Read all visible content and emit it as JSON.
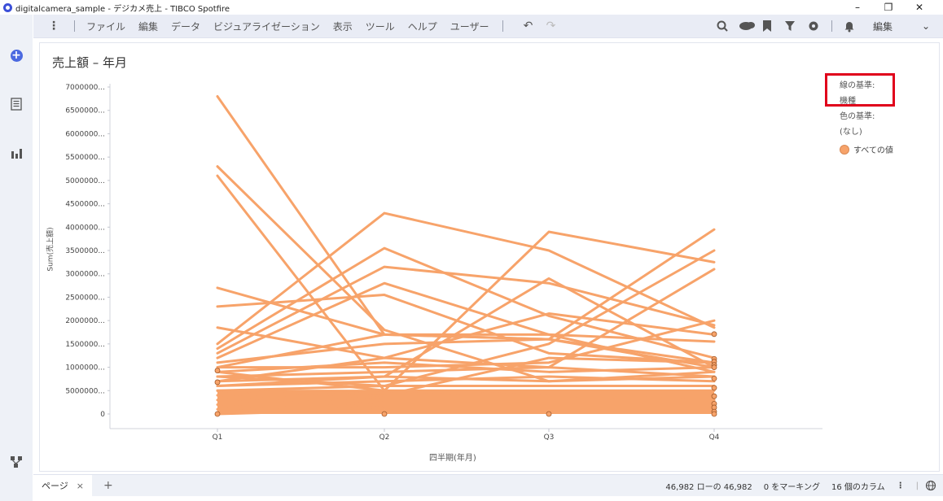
{
  "window": {
    "title": "digitalcamera_sample - デジカメ売上 - TIBCO Spotfire",
    "minimize": "–",
    "restore": "❐",
    "close": "✕"
  },
  "menu": {
    "items": [
      "ファイル",
      "編集",
      "データ",
      "ビジュアライゼーション",
      "表示",
      "ツール",
      "ヘルプ",
      "ユーザー"
    ],
    "edit_mode": "編集"
  },
  "visualization": {
    "title": "売上額 – 年月",
    "xlabel": "四半期(年月)",
    "ylabel": "Sum(売上額)"
  },
  "legend": {
    "line_by_label": "線の基準:",
    "line_by_value": "機種",
    "color_by_label": "色の基準:",
    "color_by_value": "(なし)",
    "items": [
      "すべての値"
    ],
    "highlight_color": "#e0001b"
  },
  "chart_data": {
    "type": "line",
    "categories": [
      "Q1",
      "Q2",
      "Q3",
      "Q4"
    ],
    "ylim": [
      0,
      7000000
    ],
    "yticks": [
      "0",
      "5000000...",
      "1000000...",
      "1500000...",
      "2000000...",
      "2500000...",
      "3000000...",
      "3500000...",
      "4000000...",
      "4500000...",
      "5000000...",
      "5500000...",
      "6000000...",
      "6500000...",
      "7000000..."
    ],
    "line_color": "#f7a36a",
    "series": [
      {
        "values": [
          6800000,
          1700000,
          1600000,
          1100000
        ]
      },
      {
        "values": [
          5300000,
          1800000,
          700000,
          800000
        ]
      },
      {
        "values": [
          5100000,
          500000,
          400000,
          300000
        ]
      },
      {
        "values": [
          2700000,
          1700000,
          1600000,
          1000000
        ]
      },
      {
        "values": [
          2300000,
          2550000,
          1300000,
          1100000
        ]
      },
      {
        "values": [
          1850000,
          1200000,
          2150000,
          1700000
        ]
      },
      {
        "values": [
          1500000,
          4300000,
          3500000,
          1850000
        ]
      },
      {
        "values": [
          1400000,
          3550000,
          2100000,
          1200000
        ]
      },
      {
        "values": [
          1300000,
          3150000,
          2800000,
          1900000
        ]
      },
      {
        "values": [
          1200000,
          2800000,
          1700000,
          900000
        ]
      },
      {
        "values": [
          1100000,
          1500000,
          1600000,
          3950000
        ]
      },
      {
        "values": [
          1000000,
          1700000,
          1700000,
          1550000
        ]
      },
      {
        "values": [
          900000,
          500000,
          3900000,
          3250000
        ]
      },
      {
        "values": [
          800000,
          600000,
          1500000,
          3500000
        ]
      },
      {
        "values": [
          700000,
          1200000,
          1000000,
          3100000
        ]
      },
      {
        "values": [
          600000,
          800000,
          2900000,
          1000000
        ]
      },
      {
        "values": [
          1000000,
          1000000,
          1100000,
          2000000
        ]
      },
      {
        "values": [
          500000,
          400000,
          1200000,
          1100000
        ]
      },
      {
        "values": [
          900000,
          1100000,
          900000,
          1000000
        ]
      },
      {
        "values": [
          800000,
          900000,
          1000000,
          800000
        ]
      },
      {
        "values": [
          700000,
          800000,
          700000,
          900000
        ]
      },
      {
        "values": [
          600000,
          700000,
          800000,
          700000
        ]
      },
      {
        "values": [
          500000,
          600000,
          600000,
          600000
        ]
      },
      {
        "values": [
          400000,
          500000,
          500000,
          500000
        ]
      },
      {
        "values": [
          300000,
          400000,
          400000,
          400000
        ]
      },
      {
        "values": [
          200000,
          300000,
          300000,
          300000
        ]
      },
      {
        "values": [
          100000,
          200000,
          200000,
          200000
        ]
      },
      {
        "values": [
          0,
          100000,
          100000,
          100000
        ]
      }
    ]
  },
  "status": {
    "page_tab": "ページ",
    "page_close": "×",
    "add_page": "+",
    "rows": "46,982 ローの 46,982",
    "marked": "0 をマーキング",
    "columns": "16 個のカラム"
  }
}
